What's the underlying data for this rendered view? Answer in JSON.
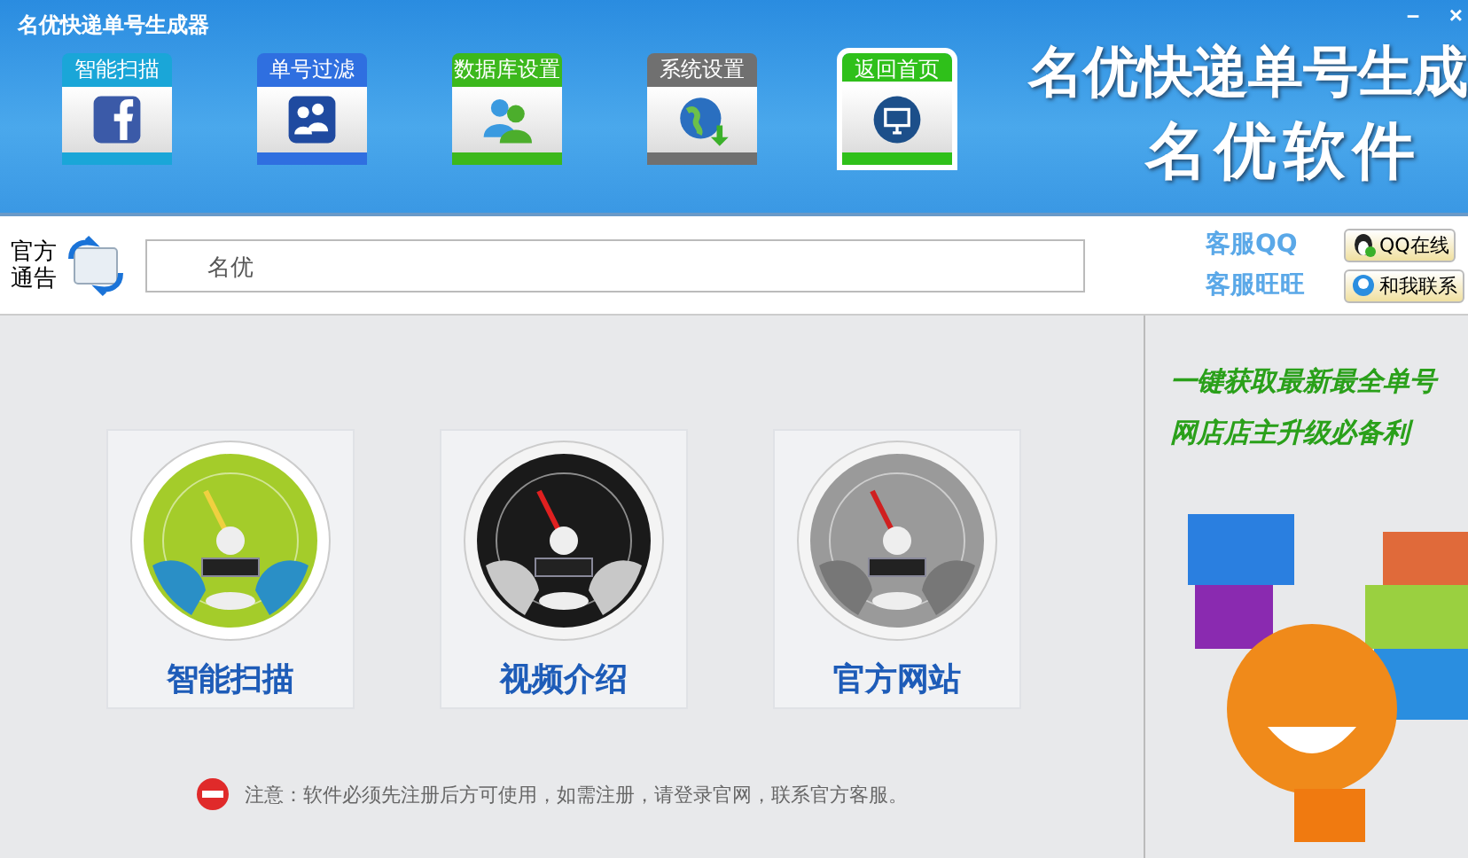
{
  "window": {
    "title": "名优快递单号生成器",
    "minimize": "－",
    "close": "×"
  },
  "toolbar": [
    {
      "label": "智能扫描",
      "color": "#1aa6d8",
      "selected": false,
      "kind": "f"
    },
    {
      "label": "单号过滤",
      "color": "#2f6fe0",
      "selected": false,
      "kind": "people"
    },
    {
      "label": "数据库设置",
      "color": "#3cb81c",
      "selected": false,
      "kind": "users"
    },
    {
      "label": "系统设置",
      "color": "#707070",
      "selected": false,
      "kind": "globe"
    },
    {
      "label": "返回首页",
      "color": "#2fc01a",
      "selected": true,
      "kind": "monitor"
    }
  ],
  "banner": {
    "title": "名优快递单号生成",
    "subtitle": "名优软件"
  },
  "notice": {
    "label_1": "官方",
    "label_2": "通告",
    "value": "名优"
  },
  "service": [
    {
      "label": "客服QQ",
      "button": "QQ在线"
    },
    {
      "label": "客服旺旺",
      "button": "和我联系"
    }
  ],
  "tiles": [
    {
      "label": "智能扫描",
      "kind": "green"
    },
    {
      "label": "视频介绍",
      "kind": "black"
    },
    {
      "label": "官方网站",
      "kind": "silver"
    }
  ],
  "footer_note": "注意：软件必须先注册后方可使用，如需注册，请登录官网，联系官方客服。",
  "ad": {
    "line_1": "一键获取最新最全单号",
    "line_2": "网店店主升级必备利"
  }
}
